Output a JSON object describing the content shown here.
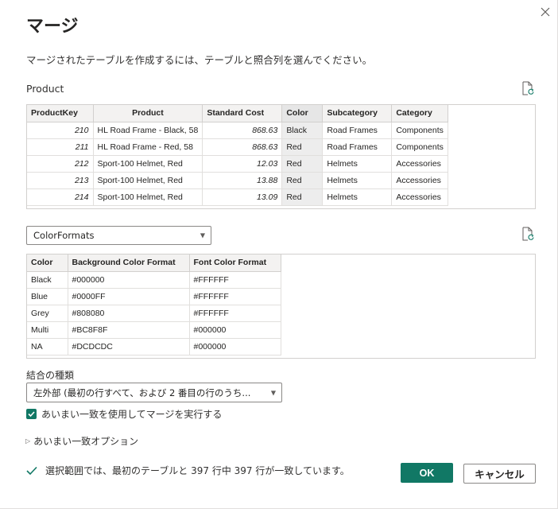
{
  "dialog": {
    "title": "マージ",
    "description": "マージされたテーブルを作成するには、テーブルと照合列を選んでください。"
  },
  "first_table": {
    "name": "Product",
    "columns": [
      "ProductKey",
      "Product",
      "Standard Cost",
      "Color",
      "Subcategory",
      "Category"
    ],
    "selected_column": "Color",
    "rows": [
      [
        "210",
        "HL Road Frame - Black, 58",
        "868.63",
        "Black",
        "Road Frames",
        "Components"
      ],
      [
        "211",
        "HL Road Frame - Red, 58",
        "868.63",
        "Red",
        "Road Frames",
        "Components"
      ],
      [
        "212",
        "Sport-100 Helmet, Red",
        "12.03",
        "Red",
        "Helmets",
        "Accessories"
      ],
      [
        "213",
        "Sport-100 Helmet, Red",
        "13.88",
        "Red",
        "Helmets",
        "Accessories"
      ],
      [
        "214",
        "Sport-100 Helmet, Red",
        "13.09",
        "Red",
        "Helmets",
        "Accessories"
      ]
    ]
  },
  "second_table": {
    "selected": "ColorFormats",
    "columns": [
      "Color",
      "Background Color Format",
      "Font Color Format"
    ],
    "rows": [
      [
        "Black",
        "#000000",
        "#FFFFFF"
      ],
      [
        "Blue",
        "#0000FF",
        "#FFFFFF"
      ],
      [
        "Grey",
        "#808080",
        "#FFFFFF"
      ],
      [
        "Multi",
        "#BC8F8F",
        "#000000"
      ],
      [
        "NA",
        "#DCDCDC",
        "#000000"
      ]
    ]
  },
  "join": {
    "label": "結合の種類",
    "selected": "左外部 (最初の行すべて、および 2 番目の行のうち..."
  },
  "fuzzy": {
    "checkbox_label": "あいまい一致を使用してマージを実行する",
    "checked": true,
    "options_label": "あいまい一致オプション"
  },
  "status": {
    "message": "選択範囲では、最初のテーブルと 397 行中 397 行が一致しています。"
  },
  "buttons": {
    "ok": "OK",
    "cancel": "キャンセル"
  },
  "colors": {
    "accent": "#117865",
    "header_bg": "#f3f2f1",
    "selected_col_bg": "#ededed",
    "success": "#117865"
  }
}
